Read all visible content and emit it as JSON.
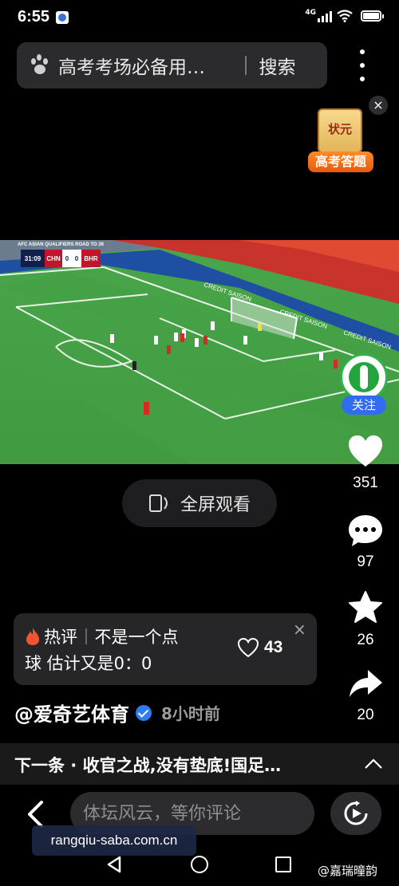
{
  "status_bar": {
    "time": "6:55",
    "network": "4G",
    "battery_level": 0.9
  },
  "search": {
    "query": "高考考场必备用…",
    "button_label": "搜索"
  },
  "promo": {
    "scroll_text": "状元",
    "ribbon_text": "高考答题",
    "close_label": "×"
  },
  "video": {
    "scoreboard": {
      "header": "AFC ASIAN QUALIFIERS  ROAD TO 26",
      "clock": "31:09",
      "home_team": "CHN",
      "home_score": "0",
      "away_score": "0",
      "away_team": "BHR"
    },
    "boards": [
      "CREDIT SAISON",
      "CREDIT SAISON",
      "CREDIT SAISON"
    ]
  },
  "follow": {
    "label": "关注"
  },
  "actions": {
    "like_count": "351",
    "comment_count": "97",
    "favorite_count": "26",
    "share_count": "20"
  },
  "fullscreen": {
    "label": "全屏观看"
  },
  "hot_comment": {
    "tag": "热评",
    "line1": "不是一个点",
    "line2": "球 估计又是0：0",
    "like_count": "43",
    "close_label": "×"
  },
  "author": {
    "name": "@爱奇艺体育",
    "time": "8小时前"
  },
  "next_video": {
    "text": "下一条 · 收官之战,没有垫底!国足…"
  },
  "comment_bar": {
    "placeholder": "体坛风云，等你评论"
  },
  "watermark": {
    "url": "rangqiu-saba.com.cn"
  },
  "source_credit": "@嘉瑞曈韵"
}
